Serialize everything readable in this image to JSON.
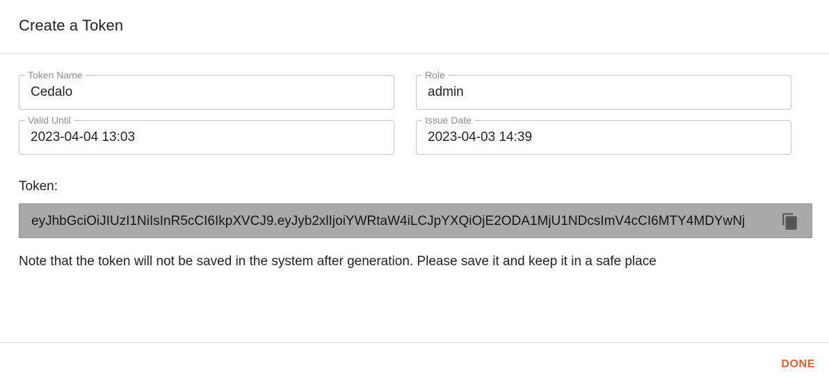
{
  "dialog": {
    "title": "Create a Token"
  },
  "fields": {
    "token_name": {
      "label": "Token Name",
      "value": "Cedalo"
    },
    "role": {
      "label": "Role",
      "value": "admin"
    },
    "valid_until": {
      "label": "Valid Until",
      "value": "2023-04-04 13:03"
    },
    "issue_date": {
      "label": "Issue Date",
      "value": "2023-04-03 14:39"
    }
  },
  "token": {
    "label": "Token:",
    "value": "eyJhbGciOiJIUzI1NiIsInR5cCI6IkpXVCJ9.eyJyb2xlIjoiYWRtaW4iLCJpYXQiOjE2ODA1MjU1NDcsImV4cCI6MTY4MDYwNj",
    "copy_icon": "copy-icon"
  },
  "note": "Note that the token will not be saved in the system after generation. Please save it and keep it in a safe place",
  "actions": {
    "done_label": "DONE"
  },
  "colors": {
    "accent": "#e8612c",
    "token_bg": "#a9a9a9",
    "icon": "#555555"
  }
}
